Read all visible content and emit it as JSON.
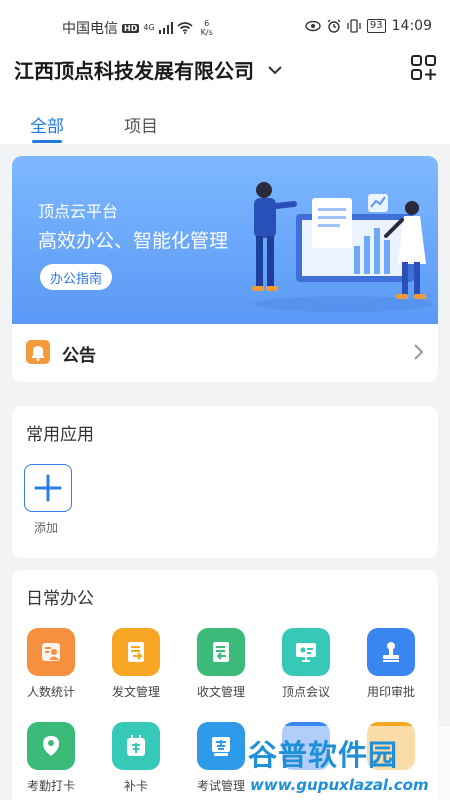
{
  "status_bar": {
    "carrier": "中国电信",
    "network_badge": "HD",
    "signal": "4G",
    "speed_value": "6",
    "speed_unit": "K/s",
    "battery": "93",
    "time": "14:09"
  },
  "header": {
    "company_name": "江西顶点科技发展有限公司"
  },
  "tabs": [
    {
      "label": "全部",
      "active": true
    },
    {
      "label": "项目",
      "active": false
    }
  ],
  "banner": {
    "line1": "顶点云平台",
    "line2": "高效办公、智能化管理",
    "button": "办公指南"
  },
  "notice": {
    "label": "公告"
  },
  "common_apps": {
    "title": "常用应用",
    "add_label": "添加"
  },
  "daily_office": {
    "title": "日常办公",
    "apps": [
      {
        "label": "人数统计",
        "icon": "people-stats-icon",
        "color": "#f6903e"
      },
      {
        "label": "发文管理",
        "icon": "send-doc-icon",
        "color": "#f6a623"
      },
      {
        "label": "收文管理",
        "icon": "receive-doc-icon",
        "color": "#3bba7a"
      },
      {
        "label": "顶点会议",
        "icon": "meeting-icon",
        "color": "#36c9b8"
      },
      {
        "label": "用印审批",
        "icon": "stamp-icon",
        "color": "#3a86f0"
      },
      {
        "label": "考勤打卡",
        "icon": "location-checkin-icon",
        "color": "#3bba7a"
      },
      {
        "label": "补卡",
        "icon": "supplement-card-icon",
        "color": "#36c9b8"
      },
      {
        "label": "考试管理",
        "icon": "exam-icon",
        "color": "#2f9ae8"
      }
    ]
  },
  "watermark": {
    "text": "谷普软件园",
    "url": "www.gupuxlazal.com"
  },
  "colors": {
    "accent": "#1f7be0",
    "banner_top": "#7eb8ff",
    "banner_bottom": "#5a99f6",
    "notice_bell": "#f59a3c"
  }
}
